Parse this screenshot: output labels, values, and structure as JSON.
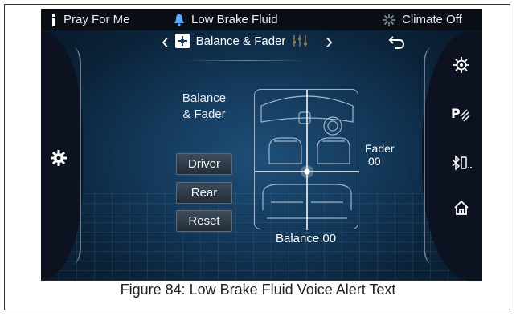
{
  "status": {
    "left_text": "Pray For Me",
    "center_text": "Low Brake Fluid",
    "right_text": "Climate Off"
  },
  "nav": {
    "title": "Balance & Fader",
    "prev_icon": "chevron-left-icon",
    "next_icon": "chevron-right-icon",
    "back_icon": "back-arrow-icon"
  },
  "balance_fader": {
    "label_line1": "Balance",
    "label_line2": "& Fader",
    "buttons": [
      "Driver",
      "Rear",
      "Reset"
    ],
    "fader_label": "Fader",
    "fader_value": "00",
    "balance_text": "Balance 00"
  },
  "right_panel_icons": [
    "settings-gear-icon",
    "park-assist-icon",
    "bluetooth-phone-icon",
    "home-icon"
  ],
  "left_panel_icons": [
    "settings-gear-icon"
  ],
  "caption": "Figure 84: Low Brake Fluid Voice Alert Text"
}
